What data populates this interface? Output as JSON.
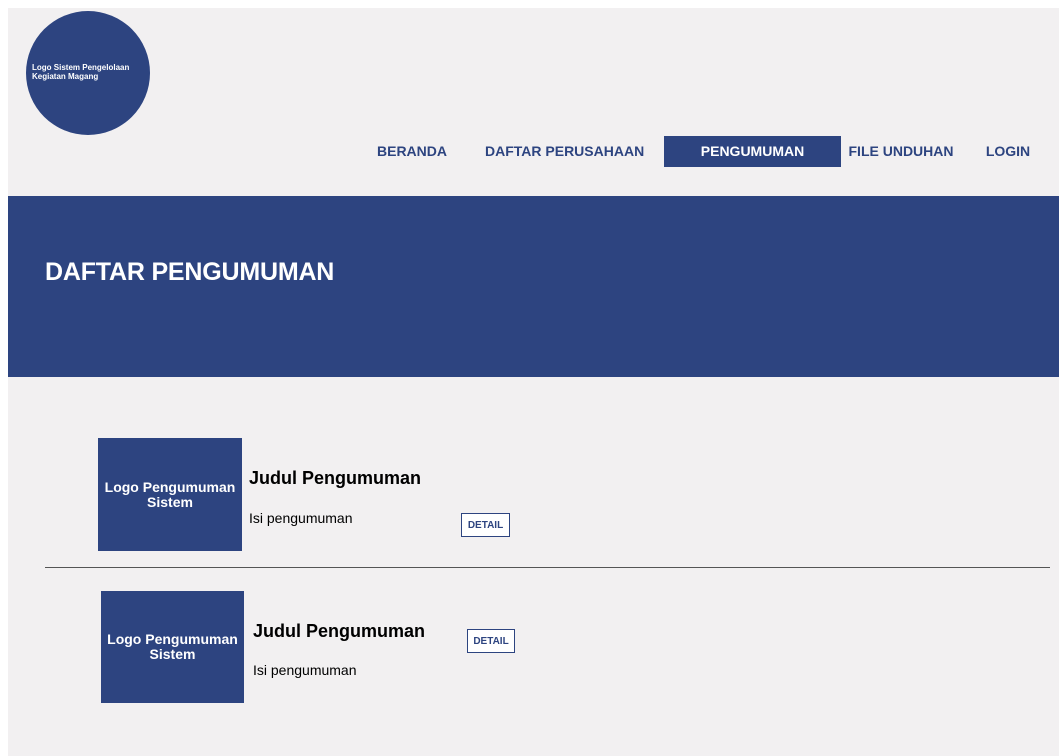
{
  "header": {
    "logo_text": "Logo Sistem Pengelolaan Kegiatan Magang"
  },
  "nav": {
    "items": [
      {
        "label": "BERANDA",
        "active": false
      },
      {
        "label": "DAFTAR PERUSAHAAN",
        "active": false
      },
      {
        "label": "PENGUMUMAN",
        "active": true
      },
      {
        "label": "FILE UNDUHAN",
        "active": false
      },
      {
        "label": "LOGIN",
        "active": false
      }
    ]
  },
  "banner": {
    "title": "DAFTAR PENGUMUMAN"
  },
  "announcements": [
    {
      "logo_text": "Logo Pengumuman Sistem",
      "title": "Judul Pengumuman",
      "body": "Isi pengumuman",
      "button_label": "DETAIL"
    },
    {
      "logo_text": "Logo Pengumuman Sistem",
      "title": "Judul Pengumuman",
      "body": "Isi pengumuman",
      "button_label": "DETAIL"
    }
  ],
  "colors": {
    "primary": "#2d4480",
    "background": "#f2f0f1",
    "text": "#000000",
    "inverse_text": "#ffffff"
  }
}
